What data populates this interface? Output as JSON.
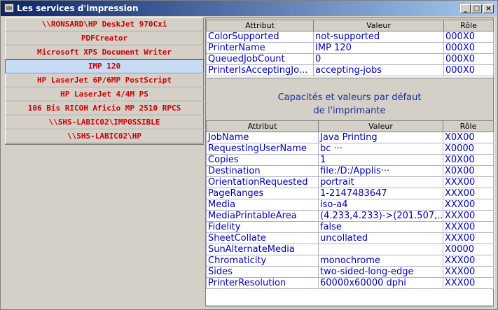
{
  "window": {
    "title": "Les services d'impression",
    "min_label": "_",
    "max_label": "□",
    "close_label": "×"
  },
  "printers": [
    "\\\\RONSARD\\HP DeskJet 970Cxi",
    "PDFCreator",
    "Microsoft XPS Document Writer",
    "IMP 120",
    "HP LaserJet 6P/6MP PostScript",
    "HP LaserJet 4/4M PS",
    "106 Bis RICOH Aficio MP 2510 RPCS",
    "\\\\SHS-LABIC02\\IMPOSSIBLE",
    "\\\\SHS-LABIC02\\HP"
  ],
  "selected_printer_index": 3,
  "attributes_table": {
    "headers": [
      "Attribut",
      "Valeur",
      "Rôle"
    ],
    "rows": [
      [
        "ColorSupported",
        "not-supported",
        "000X0"
      ],
      [
        "PrinterName",
        "IMP 120",
        "000X0"
      ],
      [
        "QueuedJobCount",
        "0",
        "000X0"
      ],
      [
        "PrinterIsAcceptingJo...",
        "accepting-jobs",
        "000X0"
      ]
    ]
  },
  "caption": {
    "line1": "Capacités et valeurs par défaut",
    "line2": "de l'imprimante"
  },
  "defaults_table": {
    "headers": [
      "Attribut",
      "Valeur",
      "Rôle"
    ],
    "rows": [
      [
        "JobName",
        "Java Printing",
        "X0X00"
      ],
      [
        "RequestingUserName",
        "bc ···",
        "X0000"
      ],
      [
        "Copies",
        "1",
        "X0X00"
      ],
      [
        "Destination",
        "file:/D:/Applis···",
        "X0X00"
      ],
      [
        "OrientationRequested",
        "portrait",
        "XXX00"
      ],
      [
        "PageRanges",
        "1-2147483647",
        "XXX00"
      ],
      [
        "Media",
        "iso-a4",
        "XXX00"
      ],
      [
        "MediaPrintableArea",
        "(4.233,4.233)->(201.507,...",
        "XXX00"
      ],
      [
        "Fidelity",
        "false",
        "XXX00"
      ],
      [
        "SheetCollate",
        "uncollated",
        "XXX00"
      ],
      [
        "SunAlternateMedia",
        "",
        "X0000"
      ],
      [
        "Chromaticity",
        "monochrome",
        "XXX00"
      ],
      [
        "Sides",
        "two-sided-long-edge",
        "XXX00"
      ],
      [
        "PrinterResolution",
        "60000x60000 dphi",
        "XXX00"
      ]
    ]
  }
}
